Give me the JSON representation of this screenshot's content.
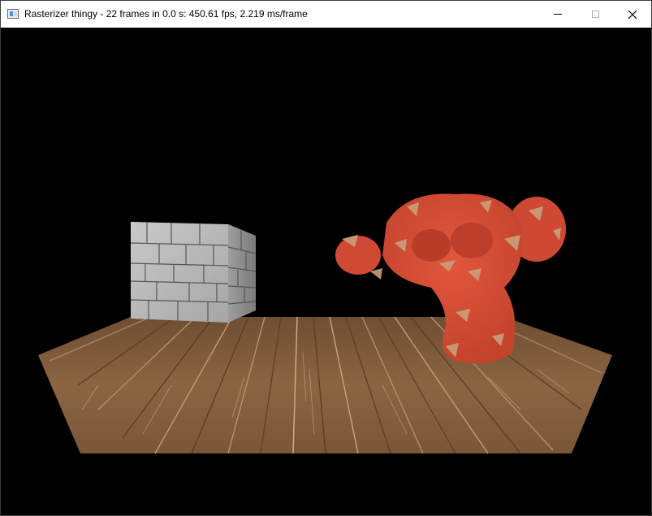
{
  "window": {
    "title": "Rasterizer thingy - 22 frames in 0.0 s: 450.61 fps, 2.219 ms/frame",
    "icon": "app-window-icon",
    "controls": {
      "minimize_icon": "minimize-icon",
      "maximize_icon": "maximize-icon",
      "close_icon": "close-icon"
    }
  },
  "scene": {
    "background": "#000000",
    "objects": [
      {
        "name": "wooden-floor",
        "texture": "wood planks",
        "color": "#8a6440"
      },
      {
        "name": "stone-cube",
        "texture": "stone bricks",
        "color": "#b9b9b9"
      },
      {
        "name": "monkey-head",
        "texture": "red rock",
        "color": "#d8503a"
      }
    ]
  }
}
